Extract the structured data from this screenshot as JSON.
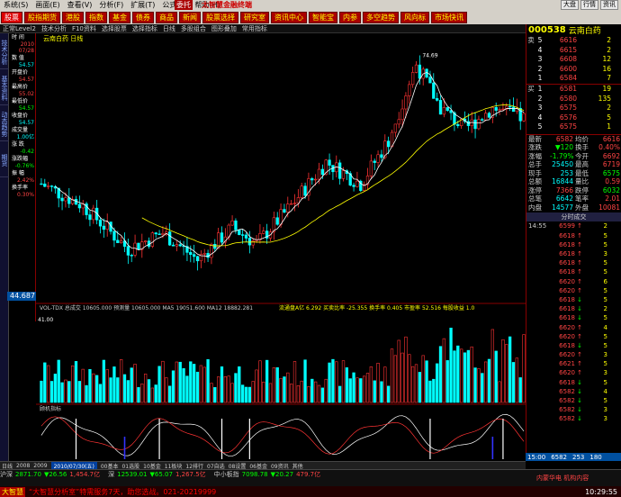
{
  "menubar": {
    "items": [
      "系统(S)",
      "画面(E)",
      "查看(V)",
      "分析(F)",
      "扩展(T)",
      "公式(U)",
      "帮助(H)"
    ],
    "brand": "太智慧金融终端",
    "badge": "委托",
    "right": [
      "大盘",
      "行情",
      "资讯"
    ]
  },
  "toolbar": {
    "buttons": [
      "股票",
      "股指期货",
      "港股",
      "指数",
      "基金",
      "债券",
      "商品",
      "新闻",
      "股票选择",
      "研究室",
      "资讯中心",
      "智能宝",
      "内参",
      "多空趋势",
      "风向标",
      "市场快讯"
    ]
  },
  "subtool": {
    "items": [
      "正常Level2",
      "技术分析",
      "F10资料",
      "选择股票",
      "选择指标",
      "日线",
      "多股组合",
      "图形叠加",
      "常用指标"
    ],
    "title": "云南白药 日线"
  },
  "lefttabs": [
    "技术分析",
    "基本资料",
    "动态趋势",
    "期货"
  ],
  "infopanel": {
    "rows": [
      {
        "k": "时 间",
        "v": "2010",
        "c": "w"
      },
      {
        "k": "",
        "v": "07/28",
        "c": "w"
      },
      {
        "k": "数 值",
        "v": "",
        "c": "w"
      },
      {
        "k": "",
        "v": "54.57",
        "c": "c"
      },
      {
        "k": "开盘价",
        "v": "54.57",
        "c": "r"
      },
      {
        "k": "最高价",
        "v": "55.02",
        "c": "r"
      },
      {
        "k": "最低价",
        "v": "54.57",
        "c": "g"
      },
      {
        "k": "收盘价",
        "v": "54.57",
        "c": "c"
      },
      {
        "k": "成交量",
        "v": "1.00亿",
        "c": "c"
      },
      {
        "k": "涨 跌",
        "v": "-0.42",
        "c": "g"
      },
      {
        "k": "涨跌幅",
        "v": "-0.76%",
        "c": "g"
      },
      {
        "k": "振 幅",
        "v": "2.42%",
        "c": "r"
      },
      {
        "k": "换手率",
        "v": "0.30%",
        "c": "r"
      }
    ]
  },
  "pricebox": "44.687",
  "chart_meta": {
    "peak_label": "74.69",
    "low_label": "41.00",
    "xdate": "2010/07/30(五)",
    "vol_line": "VOL-TDX 总成交 10605.000 预测量 10605.000 MA5 19051.600 MA12 18882.281",
    "vol_extra": "流通盘A亿 6.292 买卖比率 -25.355 换手率 0.405 市盈率 52.516 每股收益 1.0",
    "ind_title": "顾机指标"
  },
  "chart_data": {
    "type": "candlestick",
    "title": "云南白药 日线",
    "ma": true,
    "volume": true,
    "indicator_panel": true
  },
  "rpanel": {
    "code": "000538",
    "name": "云南白药",
    "asks": [
      [
        "卖",
        "5",
        "6616",
        "2"
      ],
      [
        "",
        "4",
        "6615",
        "2"
      ],
      [
        "",
        "3",
        "6608",
        "12"
      ],
      [
        "",
        "2",
        "6600",
        "16"
      ],
      [
        "",
        "1",
        "6584",
        "7"
      ]
    ],
    "bids": [
      [
        "买",
        "1",
        "6581",
        "19"
      ],
      [
        "",
        "2",
        "6580",
        "135"
      ],
      [
        "",
        "3",
        "6575",
        "2"
      ],
      [
        "",
        "4",
        "6576",
        "5"
      ],
      [
        "",
        "5",
        "6575",
        "1"
      ]
    ],
    "quote": [
      [
        "最新",
        "6582",
        "r",
        "均价",
        "6616",
        "r"
      ],
      [
        "涨跌",
        "▼120",
        "g",
        "换手",
        "0.40%",
        "r"
      ],
      [
        "涨幅",
        "-1.79%",
        "g",
        "今开",
        "6692",
        "r"
      ],
      [
        "总手",
        "25450",
        "c",
        "最高",
        "6719",
        "r"
      ],
      [
        "现手",
        "253",
        "c",
        "最低",
        "6575",
        "g"
      ],
      [
        "总额",
        "16844",
        "c",
        "量比",
        "0.59",
        "r"
      ],
      [
        "涨停",
        "7366",
        "r",
        "跌停",
        "6032",
        "g"
      ],
      [
        "总笔",
        "6642",
        "c",
        "笔率",
        "2.01",
        "r"
      ],
      [
        "内盘",
        "14577",
        "c",
        "外盘",
        "10081",
        "r"
      ]
    ],
    "tickhead": "分时成交",
    "ticks": [
      [
        "14:55",
        "6599",
        "up",
        "2"
      ],
      [
        "",
        "6618",
        "up",
        "5"
      ],
      [
        "",
        "6618",
        "up",
        "5"
      ],
      [
        "",
        "6618",
        "up",
        "3"
      ],
      [
        "",
        "6618",
        "up",
        "5"
      ],
      [
        "",
        "6618",
        "up",
        "5"
      ],
      [
        "",
        "6620",
        "up",
        "6"
      ],
      [
        "",
        "6620",
        "up",
        "5"
      ],
      [
        "",
        "6618",
        "dn",
        "5"
      ],
      [
        "",
        "6618",
        "dn",
        "2"
      ],
      [
        "",
        "6618",
        "dn",
        "5"
      ],
      [
        "",
        "6620",
        "up",
        "4"
      ],
      [
        "",
        "6620",
        "up",
        "5"
      ],
      [
        "",
        "6618",
        "dn",
        "5"
      ],
      [
        "",
        "6620",
        "up",
        "3"
      ],
      [
        "",
        "6621",
        "up",
        "5"
      ],
      [
        "",
        "6620",
        "up",
        "3"
      ],
      [
        "",
        "6618",
        "dn",
        "5"
      ],
      [
        "",
        "6582",
        "dn",
        "4"
      ],
      [
        "",
        "6582",
        "dn",
        "5"
      ],
      [
        "",
        "6582",
        "dn",
        "3"
      ],
      [
        "",
        "6582",
        "dn",
        "3"
      ]
    ],
    "foot": [
      "15:00",
      "6582",
      "253",
      "180"
    ]
  },
  "bottomtabs": [
    "日线",
    "2008",
    "2009",
    "2010/07/30(五)",
    "00基本",
    "01选股",
    "10基金",
    "11板块",
    "12排行",
    "07自选",
    "08设置",
    "06基金",
    "09资讯",
    "其他"
  ],
  "indices": [
    {
      "n": "沪深",
      "v": "2871.70",
      "v2": "▼26.56",
      "v3": "1,454.7亿",
      "g": true
    },
    {
      "n": "深",
      "v": "12539.01",
      "v2": "▼65.07",
      "v3": "1,267.5亿",
      "g": true
    },
    {
      "n": "中小板指",
      "v": "7098.78",
      "v2": "▼20.27",
      "v3": "479.7亿",
      "g": true
    }
  ],
  "scroller": {
    "label": "大智慧",
    "text": "“大智慧分析室”特需服务7天，助您选战。021-20219999",
    "clock": "10:29:55",
    "news": "内蒙华电 机构内容"
  }
}
